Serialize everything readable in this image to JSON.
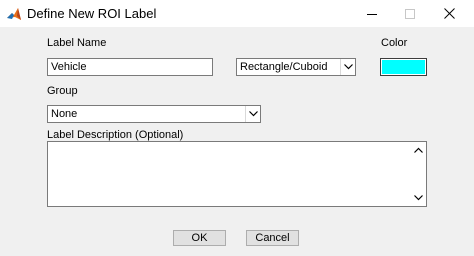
{
  "window": {
    "title": "Define New ROI Label",
    "icon": "matlab-icon",
    "controls": [
      "minimize-icon",
      "maximize-icon",
      "close-icon"
    ]
  },
  "form": {
    "label_name_caption": "Label Name",
    "label_name_value": "Vehicle",
    "shape_selected": "Rectangle/Cuboid",
    "color_caption": "Color",
    "color_value": "#00ffff",
    "group_caption": "Group",
    "group_selected": "None",
    "description_caption": "Label Description (Optional)",
    "description_value": ""
  },
  "buttons": {
    "ok": "OK",
    "cancel": "Cancel"
  }
}
